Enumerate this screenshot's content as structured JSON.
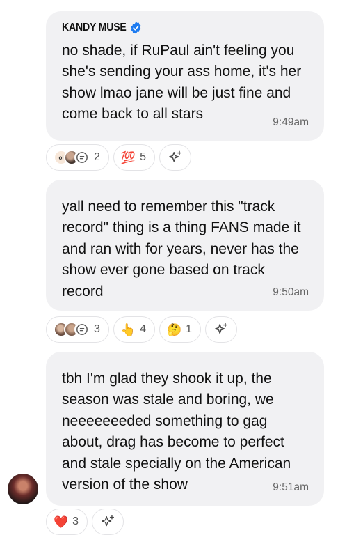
{
  "messages": [
    {
      "sender": "KANDY MUSE",
      "text": "no shade, if RuPaul ain't feeling you she's sending your ass home, it's her show lmao jane will be just fine and come back to all stars",
      "time": "9:49am",
      "reactions": {
        "thread_count": "2",
        "hundred_emoji": "💯",
        "hundred_count": "5"
      }
    },
    {
      "text": "yall need to remember this \"track record\" thing is a thing FANS made it and ran with for years, never has the show ever gone based on track record",
      "time": "9:50am",
      "reactions": {
        "thread_count": "3",
        "point_emoji": "👆",
        "point_count": "4",
        "think_emoji": "🤔",
        "think_count": "1"
      }
    },
    {
      "text": "tbh I'm glad they shook it up, the season was stale and boring, we neeeeeeeded something to gag about, drag has become to perfect and stale specially on the American version of the show",
      "time": "9:51am",
      "reactions": {
        "heart_emoji": "❤️",
        "heart_count": "3"
      }
    }
  ],
  "icons": {
    "verified": "verified-badge-icon",
    "add_reaction": "sparkle-add-reaction-icon",
    "thread": "speech-bubble-icon",
    "ol_avatar_label": "ol"
  },
  "colors": {
    "bubble": "#f1f1f3",
    "verified": "#1d7bf0",
    "timestamp": "#666666"
  }
}
